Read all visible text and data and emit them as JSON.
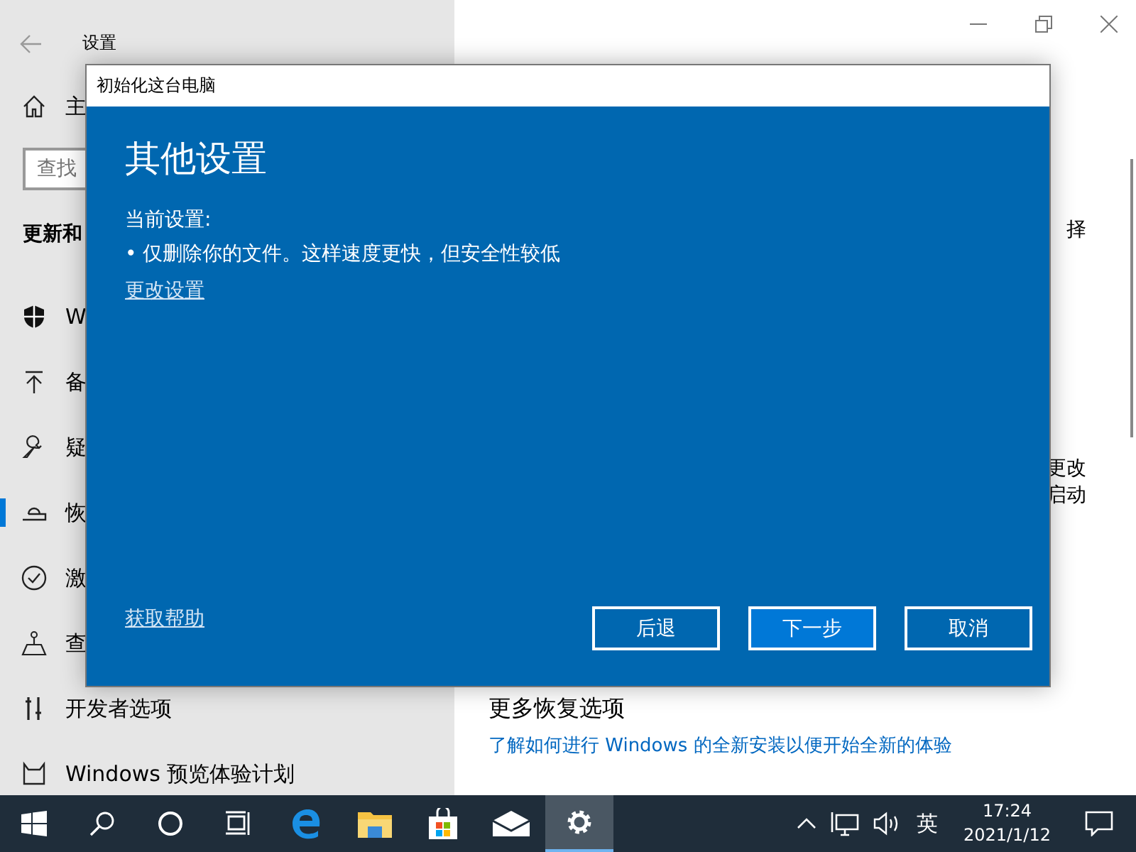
{
  "settings_window": {
    "title": "设置",
    "sidebar": {
      "home_label": "主",
      "search": {
        "placeholder": "查找"
      },
      "heading": "更新和",
      "items": [
        {
          "kind": "shield",
          "label": "W",
          "selected": false
        },
        {
          "kind": "backup",
          "label": "备",
          "selected": false
        },
        {
          "kind": "wrench",
          "label": "疑",
          "selected": false
        },
        {
          "kind": "recovery",
          "label": "恢",
          "selected": true
        },
        {
          "kind": "check",
          "label": "激",
          "selected": false
        },
        {
          "kind": "find",
          "label": "查",
          "selected": false
        },
        {
          "kind": "dev",
          "label": "开发者选项",
          "selected": false
        },
        {
          "kind": "insider",
          "label": "Windows 预览体验计划",
          "selected": false
        }
      ]
    },
    "content": {
      "fragment_1": "择",
      "fragment_2": "更改",
      "fragment_3": "启动",
      "section_heading": "更多恢复选项",
      "link": "了解如何进行 Windows 的全新安装以便开始全新的体验"
    }
  },
  "dialog": {
    "title": "初始化这台电脑",
    "heading": "其他设置",
    "current_label": "当前设置:",
    "bullets": [
      "• 仅删除你的文件。这样速度更快，但安全性较低"
    ],
    "change_link": "更改设置",
    "help_link": "获取帮助",
    "buttons": [
      {
        "label": "后退",
        "default": false
      },
      {
        "label": "下一步",
        "default": true
      },
      {
        "label": "取消",
        "default": false
      }
    ]
  },
  "taskbar": {
    "apps": [
      {
        "kind": "start",
        "active": false
      },
      {
        "kind": "search",
        "active": false
      },
      {
        "kind": "cortana",
        "active": false
      },
      {
        "kind": "taskview",
        "active": false
      },
      {
        "kind": "edge",
        "active": false
      },
      {
        "kind": "explorer",
        "active": false
      },
      {
        "kind": "store",
        "active": false
      },
      {
        "kind": "mail",
        "active": false
      },
      {
        "kind": "settings",
        "active": true
      }
    ],
    "input_method": "英",
    "time": "17:24",
    "date": "2021/1/12"
  }
}
